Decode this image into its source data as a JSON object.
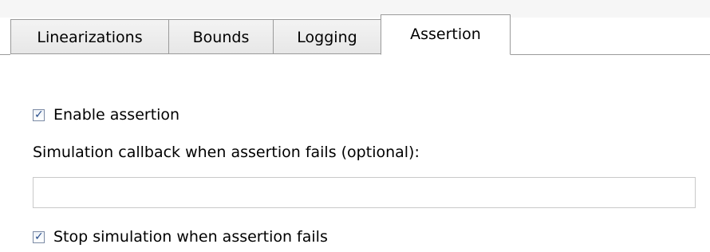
{
  "tabs": [
    {
      "label": "Linearizations",
      "active": false
    },
    {
      "label": "Bounds",
      "active": false
    },
    {
      "label": "Logging",
      "active": false
    },
    {
      "label": "Assertion",
      "active": true
    }
  ],
  "assertion": {
    "enable_label": "Enable assertion",
    "enable_checked": true,
    "callback_label": "Simulation callback when assertion fails (optional):",
    "callback_value": "",
    "stop_label": "Stop simulation when assertion fails",
    "stop_checked": true
  },
  "check_glyph": "✓"
}
